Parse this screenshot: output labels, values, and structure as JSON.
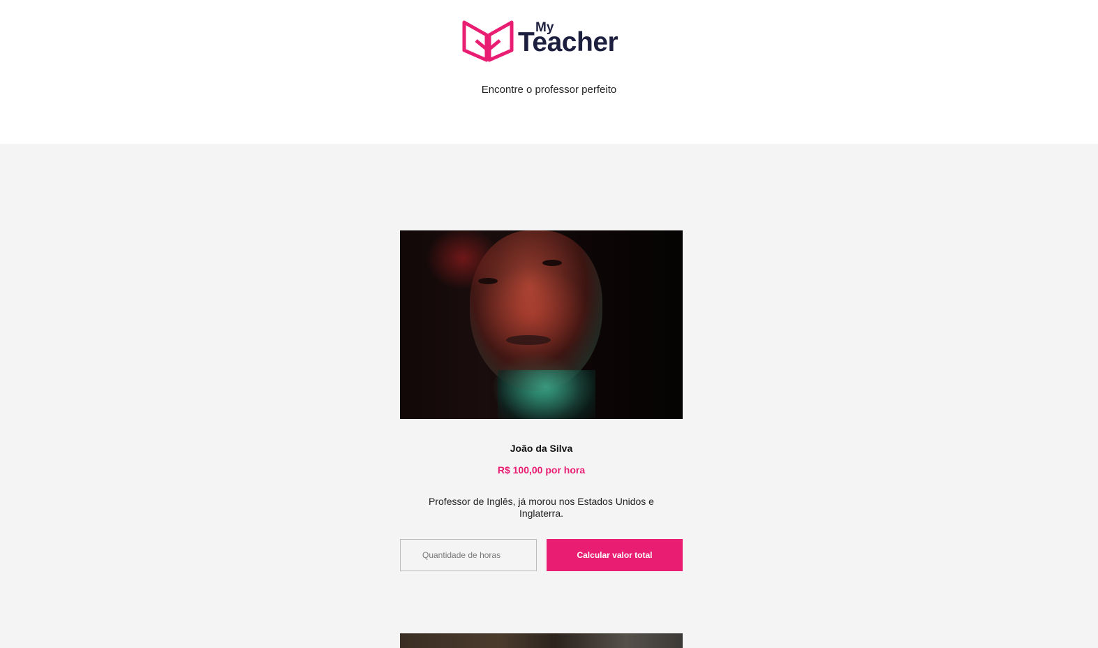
{
  "brand": {
    "logo_small": "My",
    "logo_large": "Teacher",
    "colors": {
      "primary": "#e91e73",
      "dark": "#1d1f3f"
    }
  },
  "header": {
    "tagline": "Encontre o professor perfeito"
  },
  "teachers": [
    {
      "name": "João da Silva",
      "price": "R$ 100,00 por hora",
      "description": "Professor de Inglês, já morou nos Estados Unidos e Inglaterra.",
      "hours_input": {
        "placeholder": "Quantidade de horas",
        "value": ""
      },
      "calculate_label": "Calcular valor total"
    }
  ]
}
